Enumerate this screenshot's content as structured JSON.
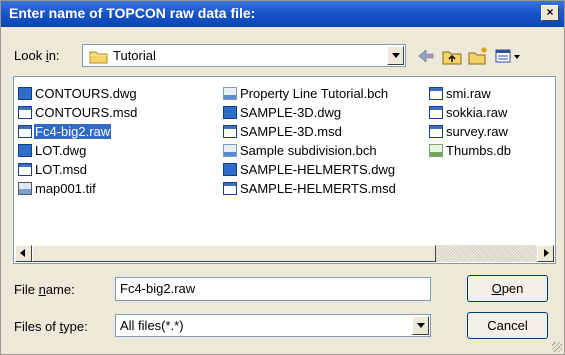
{
  "dialog": {
    "title": "Enter name of TOPCON raw data file:",
    "close_label": "×"
  },
  "lookin": {
    "label_prefix": "Look ",
    "label_hot": "i",
    "label_suffix": "n:",
    "value": "Tutorial"
  },
  "toolbar": {
    "back_icon": "back-arrow-icon",
    "up_icon": "folder-up-icon",
    "new_folder_icon": "new-folder-icon",
    "view_icon": "view-menu-icon"
  },
  "files": {
    "col1": [
      {
        "name": "CONTOURS.dwg",
        "type": "dwg"
      },
      {
        "name": "CONTOURS.msd",
        "type": "msd"
      },
      {
        "name": "Fc4-big2.raw",
        "type": "raw",
        "selected": true
      },
      {
        "name": "LOT.dwg",
        "type": "dwg"
      },
      {
        "name": "LOT.msd",
        "type": "msd"
      },
      {
        "name": "map001.tif",
        "type": "tif"
      }
    ],
    "col2": [
      {
        "name": "Property Line Tutorial.bch",
        "type": "bch"
      },
      {
        "name": "SAMPLE-3D.dwg",
        "type": "dwg"
      },
      {
        "name": "SAMPLE-3D.msd",
        "type": "msd"
      },
      {
        "name": "Sample subdivision.bch",
        "type": "bch"
      },
      {
        "name": "SAMPLE-HELMERTS.dwg",
        "type": "dwg"
      },
      {
        "name": "SAMPLE-HELMERTS.msd",
        "type": "msd"
      }
    ],
    "col3": [
      {
        "name": "smi.raw",
        "type": "raw"
      },
      {
        "name": "sokkia.raw",
        "type": "raw"
      },
      {
        "name": "survey.raw",
        "type": "raw"
      },
      {
        "name": "Thumbs.db",
        "type": "db"
      }
    ]
  },
  "filename": {
    "label_prefix": "File ",
    "label_hot": "n",
    "label_suffix": "ame:",
    "value": "Fc4-big2.raw"
  },
  "filetype": {
    "label_prefix": "Files of ",
    "label_hot": "t",
    "label_suffix": "ype:",
    "value": "All files(*.*)"
  },
  "buttons": {
    "open_hot": "O",
    "open_rest": "pen",
    "cancel": "Cancel"
  }
}
